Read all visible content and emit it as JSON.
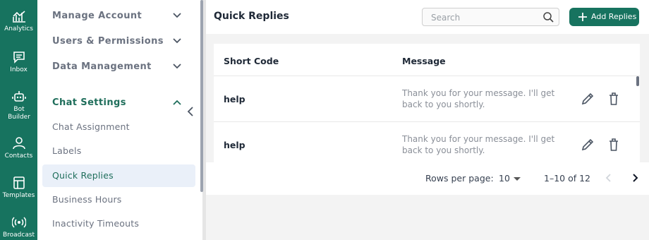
{
  "rail": {
    "items": [
      {
        "label": "Analytics",
        "icon": "analytics-icon"
      },
      {
        "label": "Inbox",
        "icon": "inbox-icon"
      },
      {
        "label": "Bot Builder",
        "icon": "bot-icon"
      },
      {
        "label": "Contacts",
        "icon": "contacts-icon"
      },
      {
        "label": "Templates",
        "icon": "templates-icon"
      },
      {
        "label": "Broadcast",
        "icon": "broadcast-icon"
      }
    ]
  },
  "sidebar": {
    "sections": [
      {
        "label": "Manage Account",
        "expanded": false
      },
      {
        "label": "Users & Permissions",
        "expanded": false
      },
      {
        "label": "Data Management",
        "expanded": false
      },
      {
        "label": "Chat Settings",
        "expanded": true
      }
    ],
    "chat_settings_items": [
      {
        "label": "Chat Assignment"
      },
      {
        "label": "Labels"
      },
      {
        "label": "Quick Replies",
        "active": true
      },
      {
        "label": "Business Hours"
      },
      {
        "label": "Inactivity Timeouts"
      }
    ]
  },
  "header": {
    "title": "Quick Replies",
    "search_placeholder": "Search",
    "add_button_label": "Add Replies"
  },
  "table": {
    "columns": [
      "Short Code",
      "Message"
    ],
    "rows": [
      {
        "short_code": "help",
        "message": "Thank you for your message. I'll get back to you shortly."
      },
      {
        "short_code": "help",
        "message": "Thank you for your message. I'll get back to you shortly."
      }
    ]
  },
  "pagination": {
    "rows_per_page_label": "Rows per page:",
    "rows_per_page_value": "10",
    "range_label": "1–10 of 12"
  },
  "colors": {
    "brand": "#17735f",
    "active_item_bg": "#eaf0f9",
    "main_bg": "#f3f3f3"
  }
}
